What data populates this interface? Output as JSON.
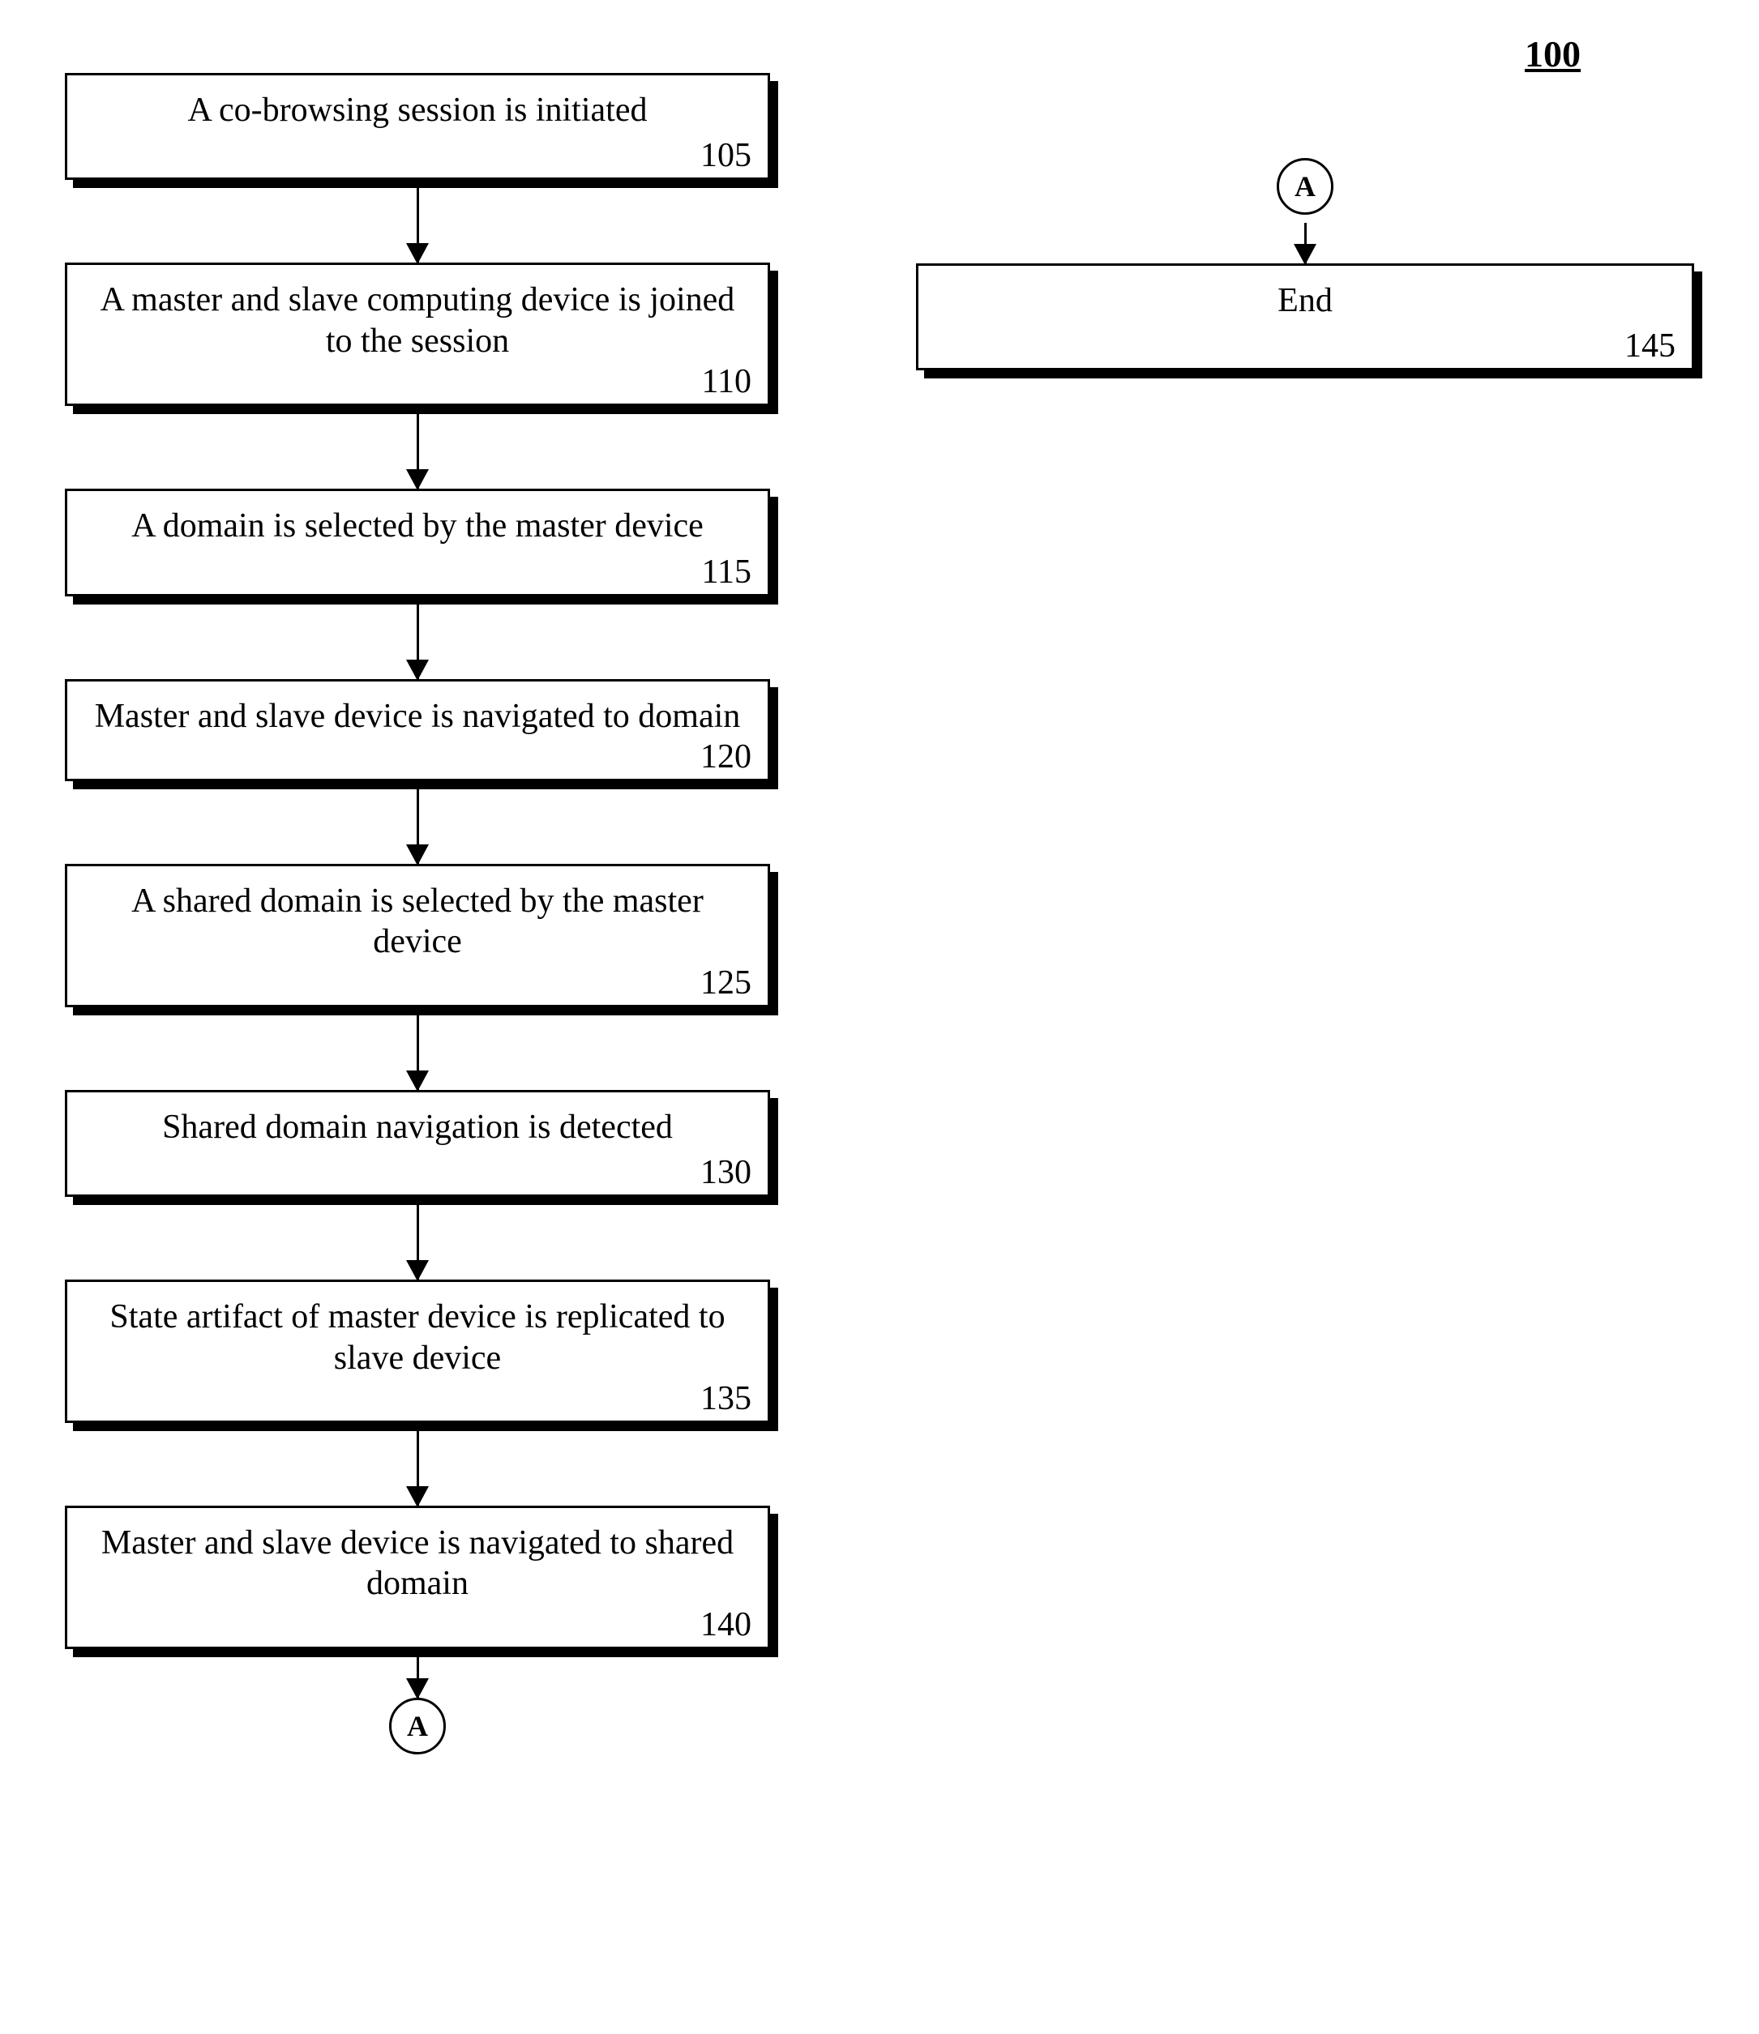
{
  "figure_number": "100",
  "left_column": [
    {
      "text": "A co-browsing session is initiated",
      "ref": "105"
    },
    {
      "text": "A master and slave computing device is joined to the session",
      "ref": "110"
    },
    {
      "text": "A domain is selected by the master device",
      "ref": "115"
    },
    {
      "text": "Master and slave device is navigated to domain",
      "ref": "120"
    },
    {
      "text": "A shared domain is selected by the master device",
      "ref": "125"
    },
    {
      "text": "Shared domain navigation is detected",
      "ref": "130"
    },
    {
      "text": "State artifact of master device is replicated to slave device",
      "ref": "135"
    },
    {
      "text": "Master and slave device is navigated to shared domain",
      "ref": "140"
    }
  ],
  "left_bottom_connector": "A",
  "right_top_connector": "A",
  "right_column": [
    {
      "text": "End",
      "ref": "145"
    }
  ]
}
